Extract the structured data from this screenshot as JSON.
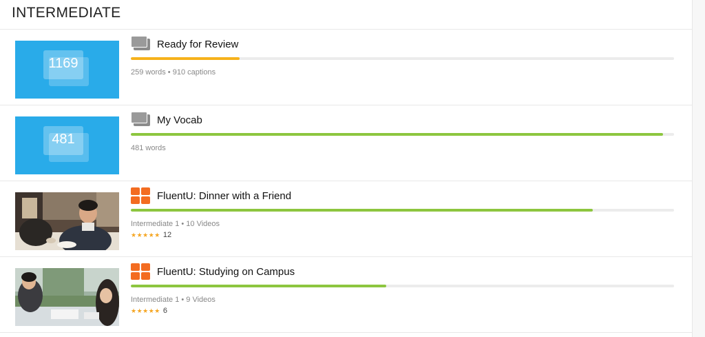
{
  "header": {
    "title": "INTERMEDIATE"
  },
  "items": [
    {
      "thumb_type": "count",
      "thumb_count": "1169",
      "icon": "flashcards-icon",
      "title": "Ready for Review",
      "progress": 0.2,
      "progress_color": "#f6b21b",
      "meta": "259 words • 910 captions"
    },
    {
      "thumb_type": "count",
      "thumb_count": "481",
      "icon": "flashcards-icon",
      "title": "My Vocab",
      "progress": 0.98,
      "progress_color": "#8dc63f",
      "meta": "481 words"
    },
    {
      "thumb_type": "photo",
      "icon": "course-grid-icon",
      "title": "FluentU: Dinner with a Friend",
      "progress": 0.85,
      "progress_color": "#8dc63f",
      "meta": "Intermediate 1 • 10 Videos",
      "stars": "★★★★★",
      "rating_count": "12"
    },
    {
      "thumb_type": "photo",
      "icon": "course-grid-icon",
      "title": "FluentU: Studying on Campus",
      "progress": 0.47,
      "progress_color": "#8dc63f",
      "meta": "Intermediate 1 • 9 Videos",
      "stars": "★★★★★",
      "rating_count": "6"
    }
  ],
  "colors": {
    "thumb_blue": "#29abe9",
    "accent_orange": "#f36c21",
    "review_yellow": "#f6b21b",
    "progress_green": "#8dc63f"
  }
}
